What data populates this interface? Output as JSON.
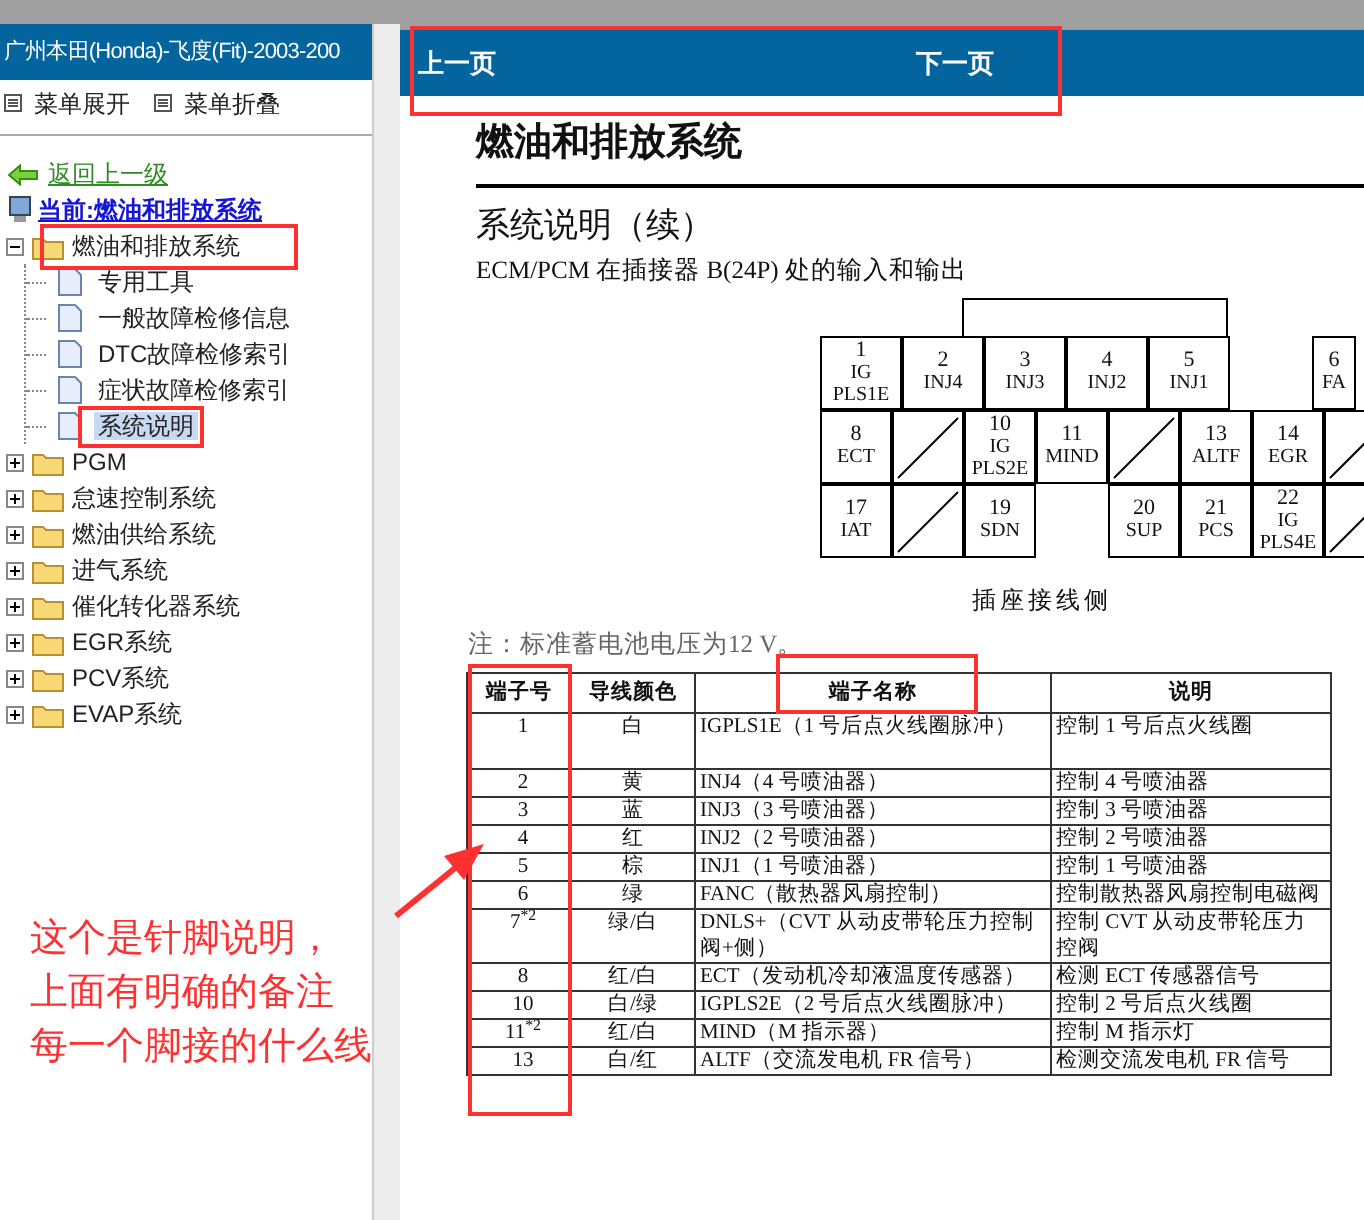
{
  "app_title": "广州本田(Honda)-飞度(Fit)-2003-200",
  "toolbar": [
    {
      "label": "菜单展开"
    },
    {
      "label": "菜单折叠"
    }
  ],
  "back_link": "返回上一级",
  "current": "当前:燃油和排放系统",
  "tree": [
    {
      "kind": "folder",
      "label": "燃油和排放系统",
      "expanded": true,
      "children": [
        {
          "kind": "page",
          "label": "专用工具",
          "selected": false
        },
        {
          "kind": "page",
          "label": "一般故障检修信息",
          "selected": false
        },
        {
          "kind": "page",
          "label": "DTC故障检修索引",
          "selected": false
        },
        {
          "kind": "page",
          "label": "症状故障检修索引",
          "selected": false
        },
        {
          "kind": "page",
          "label": "系统说明",
          "selected": true
        }
      ]
    },
    {
      "kind": "folder",
      "label": "PGM",
      "expanded": false
    },
    {
      "kind": "folder",
      "label": "怠速控制系统",
      "expanded": false
    },
    {
      "kind": "folder",
      "label": "燃油供给系统",
      "expanded": false
    },
    {
      "kind": "folder",
      "label": "进气系统",
      "expanded": false
    },
    {
      "kind": "folder",
      "label": "催化转化器系统",
      "expanded": false
    },
    {
      "kind": "folder",
      "label": "EGR系统",
      "expanded": false
    },
    {
      "kind": "folder",
      "label": "PCV系统",
      "expanded": false
    },
    {
      "kind": "folder",
      "label": "EVAP系统",
      "expanded": false
    }
  ],
  "nav": {
    "prev": "上一页",
    "next": "下一页"
  },
  "document": {
    "title": "燃油和排放系统",
    "subtitle": "系统说明（续）",
    "caption": "ECM/PCM 在插接器 B(24P) 处的输入和输出",
    "connector": {
      "rows": [
        [
          {
            "kind": "pin",
            "number": "1",
            "label": [
              "IG",
              "PLS1E"
            ]
          },
          {
            "kind": "pin",
            "number": "2",
            "label": [
              "INJ4"
            ]
          },
          {
            "kind": "pin",
            "number": "3",
            "label": [
              "INJ3"
            ]
          },
          {
            "kind": "pin",
            "number": "4",
            "label": [
              "INJ2"
            ]
          },
          {
            "kind": "pin",
            "number": "5",
            "label": [
              "INJ1"
            ]
          },
          {
            "kind": "gap"
          },
          {
            "kind": "pin",
            "number": "6",
            "label": [
              "FA"
            ]
          }
        ],
        [
          {
            "kind": "pin",
            "number": "8",
            "label": [
              "ECT"
            ]
          },
          {
            "kind": "blank"
          },
          {
            "kind": "pin",
            "number": "10",
            "label": [
              "IG",
              "PLS2E"
            ]
          },
          {
            "kind": "pin",
            "number": "11",
            "label": [
              "MIND"
            ]
          },
          {
            "kind": "blank"
          },
          {
            "kind": "pin",
            "number": "13",
            "label": [
              "ALTF"
            ]
          },
          {
            "kind": "pin",
            "number": "14",
            "label": [
              "EGR"
            ]
          },
          {
            "kind": "blank"
          }
        ],
        [
          {
            "kind": "pin",
            "number": "17",
            "label": [
              "IAT"
            ]
          },
          {
            "kind": "blank"
          },
          {
            "kind": "pin",
            "number": "19",
            "label": [
              "SDN"
            ]
          },
          {
            "kind": "gap"
          },
          {
            "kind": "pin",
            "number": "20",
            "label": [
              "SUP"
            ]
          },
          {
            "kind": "pin",
            "number": "21",
            "label": [
              "PCS"
            ]
          },
          {
            "kind": "pin",
            "number": "22",
            "label": [
              "IG",
              "PLS4E"
            ]
          },
          {
            "kind": "blank"
          }
        ]
      ]
    },
    "connector_caption": "插座接线侧",
    "note": "注：标准蓄电池电压为12 V。",
    "table": {
      "columns": [
        "端子号",
        "导线颜色",
        "端子名称",
        "说明"
      ],
      "rows": [
        [
          "1",
          "白",
          "IGPLS1E（1 号后点火线圈脉冲）",
          "控制 1 号后点火线圈"
        ],
        [
          "2",
          "黄",
          "INJ4（4 号喷油器）",
          "控制 4 号喷油器"
        ],
        [
          "3",
          "蓝",
          "INJ3（3 号喷油器）",
          "控制 3 号喷油器"
        ],
        [
          "4",
          "红",
          "INJ2（2 号喷油器）",
          "控制 2 号喷油器"
        ],
        [
          "5",
          "棕",
          "INJ1（1 号喷油器）",
          "控制 1 号喷油器"
        ],
        [
          "6",
          "绿",
          "FANC（散热器风扇控制）",
          "控制散热器风扇控制电磁阀"
        ],
        [
          "7$^{*2}$",
          "绿/白",
          "DNLS+（CVT 从动皮带轮压力控制阀+侧）",
          "控制 CVT 从动皮带轮压力控阀"
        ],
        [
          "8",
          "红/白",
          "ECT（发动机冷却液温度传感器）",
          "检测 ECT 传感器信号"
        ],
        [
          "10",
          "白/绿",
          "IGPLS2E（2 号后点火线圈脉冲）",
          "控制 2 号后点火线圈"
        ],
        [
          "11$^{*2}$",
          "红/白",
          "MIND（M 指示器）",
          "控制 M 指示灯"
        ],
        [
          "13",
          "白/红",
          "ALTF（交流发电机 FR 信号）",
          "检测交流发电机 FR 信号"
        ]
      ]
    }
  },
  "annotation": {
    "lines": [
      "这个是针脚说明，",
      "上面有明确的备注",
      "每一个脚接的什么线"
    ]
  }
}
